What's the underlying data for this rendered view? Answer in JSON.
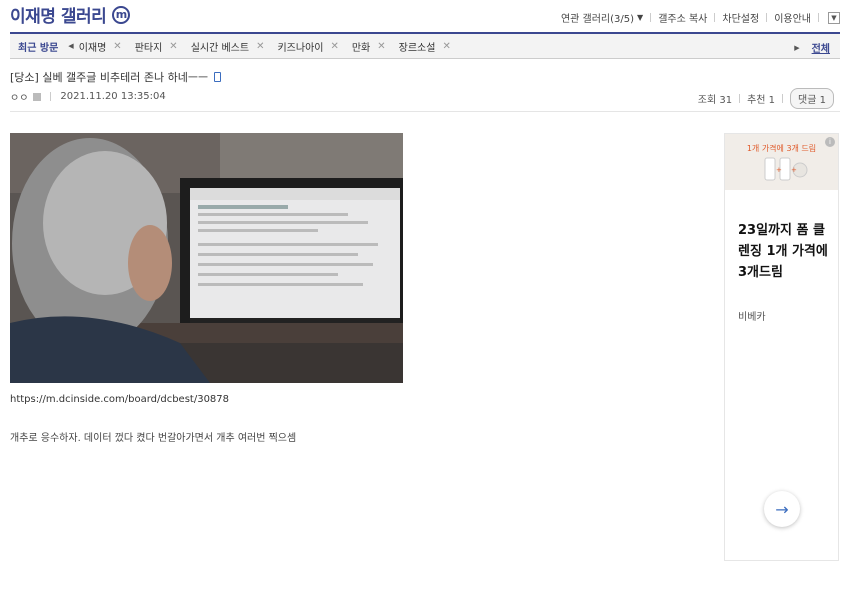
{
  "header": {
    "gallery_title": "이재명 갤러리",
    "gallery_badge": "ⓜ",
    "links": {
      "related": "연관 갤러리(3/5)",
      "copy_addr": "갤주소 복사",
      "block_settings": "차단설정",
      "guide": "이용안내"
    }
  },
  "visit_bar": {
    "label": "최근 방문",
    "items": [
      "이재명",
      "판타지",
      "실시간 베스트",
      "키즈나아이",
      "만화",
      "장르소설"
    ],
    "all_label": "전체"
  },
  "post": {
    "title": "[당소] 실베 갤주글 비추테러 존나 하네ㅡㅡ",
    "writer": "ㅇㅇ",
    "date": "2021.11.20 13:35:04",
    "views": "조회 31",
    "recommends": "추천 1",
    "comments": "댓글 1",
    "link": "https://m.dcinside.com/board/dcbest/30878",
    "body": "개추로 응수하자. 데이터 껐다 켰다 번갈아가면서 개추 여러번 찍으셈"
  },
  "ad": {
    "image_text_small": "",
    "image_text_main": "1개 가격에 3개 드림",
    "headline": "23일까지 폼 클렌징 1개 가격에 3개드림",
    "brand": "비베카",
    "info_icon": "info-icon",
    "arrow_icon": "arrow-right-icon"
  },
  "colors": {
    "brand": "#3b4890",
    "link": "#3b6dbf"
  }
}
